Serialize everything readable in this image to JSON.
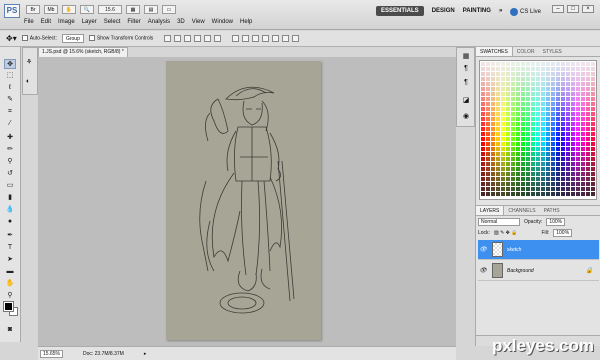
{
  "app": {
    "logo": "PS",
    "zoom_value": "15.6",
    "menu": [
      "File",
      "Edit",
      "Image",
      "Layer",
      "Select",
      "Filter",
      "Analysis",
      "3D",
      "View",
      "Window",
      "Help"
    ],
    "workspaces": [
      "ESSENTIALS",
      "DESIGN",
      "PAINTING"
    ],
    "cslive": "CS Live"
  },
  "options": {
    "auto_select_label": "Auto-Select:",
    "auto_select_value": "Group",
    "show_transform_label": "Show Transform Controls"
  },
  "document": {
    "tab_title": "1.JS.psd @ 15.6% (sketch, RGB/8) *",
    "status_zoom": "15.65%",
    "status_doc": "Doc: 23.7M/8.37M"
  },
  "swatches": {
    "tabs": [
      "SWATCHES",
      "COLOR",
      "STYLES"
    ]
  },
  "layers": {
    "tabs": [
      "LAYERS",
      "CHANNELS",
      "PATHS"
    ],
    "blend_mode": "Normal",
    "opacity_label": "Opacity:",
    "opacity_value": "100%",
    "lock_label": "Lock:",
    "fill_label": "Fill:",
    "fill_value": "100%",
    "items": [
      {
        "name": "sketch"
      },
      {
        "name": "Background"
      }
    ]
  },
  "watermark": "pxleyes.com",
  "colors": {
    "canvas": "#a6a596",
    "selected_layer": "#3d8ff0",
    "foreground": "#000000",
    "background": "#ffffff"
  }
}
